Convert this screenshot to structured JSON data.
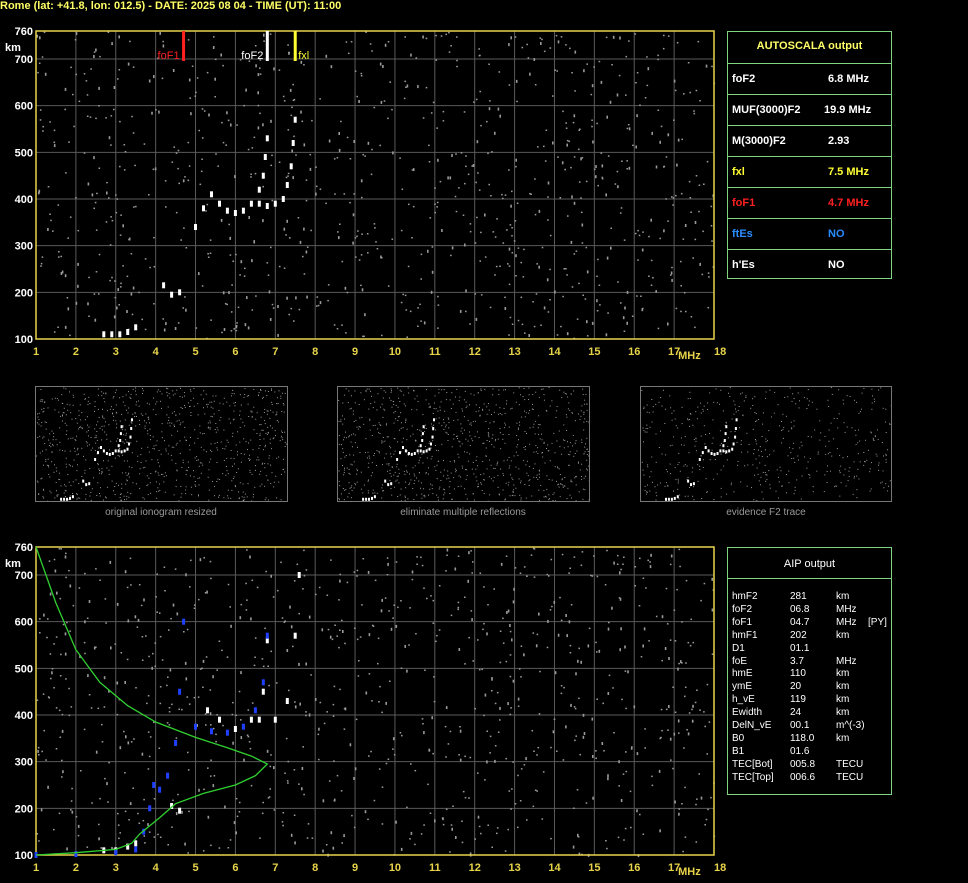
{
  "header": {
    "title": "Rome (lat: +41.8, lon: 012.5) - DATE: 2025 08 04 - TIME (UT): 11:00"
  },
  "colors": {
    "axis": "#e8d44a",
    "grid": "#5a5a5a",
    "trace": "#ffffff",
    "fof1_marker": "#ff2020",
    "fof2_marker": "#ffffff",
    "fxl_marker": "#ffff33",
    "profile": "#30d030",
    "aip_trace": "#2040ff",
    "panel_border": "#7fd47f"
  },
  "chart_data": [
    {
      "type": "scatter",
      "xlabel": "MHz",
      "ylabel": "km",
      "xlim": [
        1,
        18
      ],
      "ylim": [
        100,
        760
      ],
      "x_ticks": [
        "1",
        "2",
        "3",
        "4",
        "5",
        "6",
        "7",
        "8",
        "9",
        "10",
        "11",
        "12",
        "13",
        "14",
        "15",
        "16",
        "17",
        "18"
      ],
      "y_ticks": [
        "100",
        "200",
        "300",
        "400",
        "500",
        "600",
        "700",
        "760"
      ],
      "grid": true,
      "markers": [
        {
          "label": "foF1",
          "x": 4.7
        },
        {
          "label": "foF2",
          "x": 6.8
        },
        {
          "label": "fxl",
          "x": 7.5
        }
      ],
      "series": [
        {
          "points": [
            [
              2.7,
              110
            ],
            [
              2.9,
              110
            ],
            [
              3.1,
              110
            ],
            [
              3.3,
              115
            ],
            [
              3.5,
              125
            ],
            [
              4.2,
              215
            ],
            [
              4.4,
              195
            ],
            [
              4.6,
              200
            ],
            [
              5.0,
              340
            ],
            [
              5.2,
              380
            ],
            [
              5.4,
              410
            ],
            [
              5.6,
              390
            ],
            [
              5.8,
              375
            ],
            [
              6.0,
              370
            ],
            [
              6.2,
              375
            ],
            [
              6.4,
              390
            ],
            [
              6.6,
              420
            ],
            [
              6.7,
              450
            ],
            [
              6.75,
              490
            ],
            [
              6.8,
              530
            ],
            [
              6.6,
              390
            ],
            [
              6.8,
              385
            ],
            [
              7.0,
              390
            ],
            [
              7.2,
              400
            ],
            [
              7.3,
              430
            ],
            [
              7.4,
              470
            ],
            [
              7.45,
              520
            ],
            [
              7.5,
              570
            ]
          ]
        }
      ]
    },
    {
      "type": "scatter",
      "xlabel": "MHz",
      "ylabel": "km",
      "xlim": [
        1,
        18
      ],
      "ylim": [
        100,
        760
      ],
      "x_ticks": [
        "1",
        "2",
        "3",
        "4",
        "5",
        "6",
        "7",
        "8",
        "9",
        "10",
        "11",
        "12",
        "13",
        "14",
        "15",
        "16",
        "17",
        "18"
      ],
      "y_ticks": [
        "100",
        "200",
        "300",
        "400",
        "500",
        "600",
        "700",
        "760"
      ],
      "grid": true,
      "series": [
        {
          "points": [
            [
              2.7,
              110
            ],
            [
              3.0,
              110
            ],
            [
              3.3,
              118
            ],
            [
              3.5,
              125
            ],
            [
              4.4,
              205
            ],
            [
              4.6,
              195
            ],
            [
              5.3,
              410
            ],
            [
              5.6,
              390
            ],
            [
              6.0,
              370
            ],
            [
              6.4,
              390
            ],
            [
              6.7,
              450
            ],
            [
              6.8,
              560
            ],
            [
              6.6,
              390
            ],
            [
              7.0,
              390
            ],
            [
              7.3,
              430
            ],
            [
              7.5,
              570
            ],
            [
              7.6,
              700
            ]
          ]
        },
        {
          "name": "",
          "points": [
            [
              1.0,
              100
            ],
            [
              2.0,
              102
            ],
            [
              3.0,
              106
            ],
            [
              3.5,
              112
            ],
            [
              3.7,
              150
            ],
            [
              3.85,
              200
            ],
            [
              3.95,
              250
            ],
            [
              4.1,
              240
            ],
            [
              4.3,
              270
            ],
            [
              4.5,
              340
            ],
            [
              4.6,
              450
            ],
            [
              4.7,
              600
            ],
            [
              5.0,
              375
            ],
            [
              5.4,
              365
            ],
            [
              5.8,
              362
            ],
            [
              6.2,
              375
            ],
            [
              6.5,
              410
            ],
            [
              6.7,
              470
            ],
            [
              6.8,
              570
            ]
          ]
        },
        {
          "points": [
            [
              1.0,
              760
            ],
            [
              1.5,
              640
            ],
            [
              2.0,
              540
            ],
            [
              2.6,
              470
            ],
            [
              3.3,
              420
            ],
            [
              4.0,
              385
            ],
            [
              5.0,
              352
            ],
            [
              5.8,
              330
            ],
            [
              6.4,
              312
            ],
            [
              6.8,
              295
            ],
            [
              6.5,
              270
            ],
            [
              6.0,
              250
            ],
            [
              5.2,
              232
            ],
            [
              4.5,
              210
            ],
            [
              4.1,
              180
            ],
            [
              3.6,
              145
            ],
            [
              3.4,
              125
            ],
            [
              3.0,
              112
            ],
            [
              2.0,
              105
            ],
            [
              1.0,
              100
            ]
          ]
        }
      ]
    }
  ],
  "autoscala": {
    "title": "AUTOSCALA output",
    "rows": [
      {
        "key": "foF2",
        "value": "6.8 MHz",
        "color": "#ffffff"
      },
      {
        "key": "MUF(3000)F2",
        "value": "19.9 MHz",
        "color": "#ffffff"
      },
      {
        "key": "M(3000)F2",
        "value": "2.93",
        "color": "#ffffff"
      },
      {
        "key": "fxl",
        "value": "7.5 MHz",
        "color": "#ffff33"
      },
      {
        "key": "foF1",
        "value": "4.7 MHz",
        "color": "#ff2020"
      },
      {
        "key": "ftEs",
        "value": "NO",
        "color": "#2a8cff"
      },
      {
        "key": "h'Es",
        "value": "NO",
        "color": "#ffffff"
      }
    ]
  },
  "thumbnails": [
    {
      "caption": "original ionogram resized"
    },
    {
      "caption": "eliminate multiple reflections"
    },
    {
      "caption": "evidence F2 trace"
    }
  ],
  "aip": {
    "title": "AIP output",
    "rows": [
      {
        "k": "hmF2",
        "v": "281",
        "u": "km",
        "x": ""
      },
      {
        "k": "foF2",
        "v": "06.8",
        "u": "MHz",
        "x": ""
      },
      {
        "k": "foF1",
        "v": "04.7",
        "u": "MHz",
        "x": "[PY]"
      },
      {
        "k": "hmF1",
        "v": "202",
        "u": "km",
        "x": ""
      },
      {
        "k": "D1",
        "v": "01.1",
        "u": "",
        "x": ""
      },
      {
        "k": "foE",
        "v": "3.7",
        "u": "MHz",
        "x": ""
      },
      {
        "k": "hmE",
        "v": "110",
        "u": "km",
        "x": ""
      },
      {
        "k": "ymE",
        "v": "20",
        "u": "km",
        "x": ""
      },
      {
        "k": "h_vE",
        "v": "119",
        "u": "km",
        "x": ""
      },
      {
        "k": "Ewidth",
        "v": "24",
        "u": "km",
        "x": ""
      },
      {
        "k": "DelN_vE",
        "v": "00.1",
        "u": "m^(-3)",
        "x": ""
      },
      {
        "k": "B0",
        "v": "118.0",
        "u": "km",
        "x": ""
      },
      {
        "k": "B1",
        "v": "01.6",
        "u": "",
        "x": ""
      },
      {
        "k": "TEC[Bot]",
        "v": "005.8",
        "u": "TECU",
        "x": ""
      },
      {
        "k": "TEC[Top]",
        "v": "006.6",
        "u": "TECU",
        "x": ""
      }
    ]
  }
}
